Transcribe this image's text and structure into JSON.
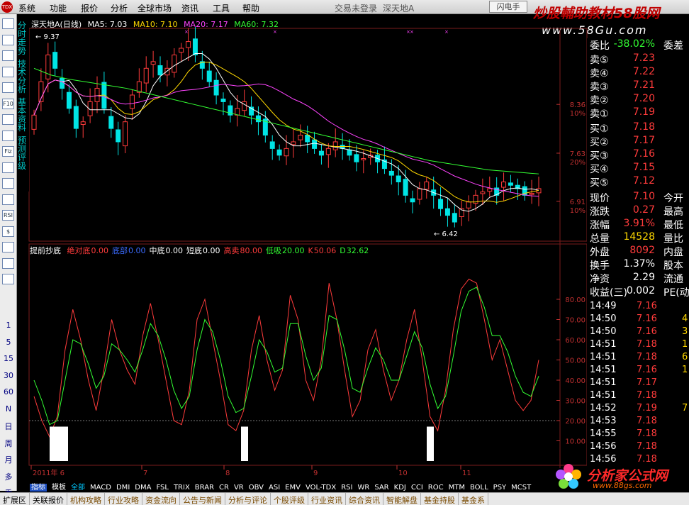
{
  "menu": {
    "items": [
      "系统",
      "功能",
      "报价",
      "分析",
      "全球市场",
      "资讯",
      "工具",
      "帮助"
    ],
    "center": "交易未登录",
    "center2": "深天地A",
    "button": "闪电手"
  },
  "watermark": {
    "line1": "炒股輔助教材58股网",
    "line2": "www.58Gu.com",
    "logo_text": "分析家公式网",
    "logo_url": "www.88gs.com"
  },
  "left_toolbar": {
    "icons": [
      "quote-list-icon",
      "k-line-icon",
      "minute-line-icon",
      "multi-chart-icon",
      "bar-chart-icon",
      "f10-icon",
      "notepad-icon",
      "formula-icon",
      "file-icon",
      "search-icon",
      "grid-icon",
      "rsi-icon",
      "dollar-icon",
      "drag-icon",
      "arrow-icon",
      "pencil-icon",
      "f5-icon"
    ],
    "icon_labels": [
      "",
      "",
      "",
      "",
      "",
      "F10",
      "",
      "",
      "Fiz",
      "",
      "",
      "",
      "RSI",
      "$",
      "",
      "",
      ""
    ],
    "periods": [
      "1",
      "5",
      "15",
      "30",
      "60",
      "N",
      "日",
      "周",
      "月",
      "多",
      "季"
    ]
  },
  "vtabs": [
    "分时走势",
    "技术分析",
    "基本资料",
    "预测评级"
  ],
  "kline": {
    "stock": "深天地A",
    "period": "(日线)",
    "ma5": "MA5: 7.03",
    "ma10": "MA10: 7.10",
    "ma20": "MA20: 7.17",
    "ma60": "MA60: 7.32",
    "high_label": "9.37",
    "low_label": "6.42",
    "price_labels": [
      "8.36",
      "7.63",
      "6.91"
    ],
    "pct_labels": [
      "10%",
      "20%",
      "10%"
    ],
    "date_labels": [
      "2011年 6",
      "7",
      "8",
      "9",
      "10",
      "11"
    ]
  },
  "indicator": {
    "name": "提前抄底",
    "items": [
      {
        "label": "绝对底",
        "value": "0.00",
        "color": "#ff3b3b"
      },
      {
        "label": "底部",
        "value": "0.00",
        "color": "#3b6bff"
      },
      {
        "label": "中底",
        "value": "0.00",
        "color": "#ffffff"
      },
      {
        "label": "短底",
        "value": "0.00",
        "color": "#ffffff"
      },
      {
        "label": "高卖",
        "value": "80.00",
        "color": "#ff3b3b"
      },
      {
        "label": "低吸",
        "value": "20.00",
        "color": "#33ff33"
      },
      {
        "label": "K",
        "value": "50.06",
        "color": "#ff3b3b"
      },
      {
        "label": "D",
        "value": "32.62",
        "color": "#33ff33"
      }
    ],
    "y_labels": [
      "80.00",
      "70.00",
      "60.00",
      "50.00",
      "40.00",
      "30.00",
      "20.00",
      "10.00"
    ]
  },
  "quote": {
    "diff_label": "委比",
    "diff_value": "-38.02%",
    "diff_right": "委差",
    "sells": [
      {
        "label": "卖⑤",
        "price": "7.23"
      },
      {
        "label": "卖④",
        "price": "7.22"
      },
      {
        "label": "卖③",
        "price": "7.21"
      },
      {
        "label": "卖②",
        "price": "7.20"
      },
      {
        "label": "卖①",
        "price": "7.19"
      }
    ],
    "buys": [
      {
        "label": "买①",
        "price": "7.18"
      },
      {
        "label": "买②",
        "price": "7.17"
      },
      {
        "label": "买③",
        "price": "7.16"
      },
      {
        "label": "买④",
        "price": "7.15"
      },
      {
        "label": "买⑤",
        "price": "7.12"
      }
    ],
    "stats": [
      {
        "l": "现价",
        "v": "7.10",
        "r": "今开",
        "c": "#ff3b3b"
      },
      {
        "l": "涨跌",
        "v": "0.27",
        "r": "最高",
        "c": "#ff3b3b"
      },
      {
        "l": "涨幅",
        "v": "3.91%",
        "r": "最低",
        "c": "#ff3b3b"
      },
      {
        "l": "总量",
        "v": "14528",
        "r": "量比",
        "c": "#ffd800"
      },
      {
        "l": "外盘",
        "v": "8092",
        "r": "内盘",
        "c": "#ff3b3b"
      },
      {
        "l": "换手",
        "v": "1.37%",
        "r": "股本",
        "c": "#ffffff"
      },
      {
        "l": "净资",
        "v": "2.29",
        "r": "流通",
        "c": "#ffffff"
      },
      {
        "l": "收益(三)",
        "v": "0.002",
        "r": "PE(动)",
        "c": "#ffffff"
      }
    ],
    "ticks": [
      {
        "t": "14:49",
        "p": "7.16",
        "v": ""
      },
      {
        "t": "14:50",
        "p": "7.16",
        "v": "4"
      },
      {
        "t": "14:50",
        "p": "7.16",
        "v": "3"
      },
      {
        "t": "14:51",
        "p": "7.18",
        "v": "1"
      },
      {
        "t": "14:51",
        "p": "7.18",
        "v": "6"
      },
      {
        "t": "14:51",
        "p": "7.16",
        "v": "1"
      },
      {
        "t": "14:51",
        "p": "7.17",
        "v": ""
      },
      {
        "t": "14:51",
        "p": "7.18",
        "v": ""
      },
      {
        "t": "14:52",
        "p": "7.19",
        "v": "7"
      },
      {
        "t": "14:53",
        "p": "7.18",
        "v": ""
      },
      {
        "t": "14:55",
        "p": "7.18",
        "v": ""
      },
      {
        "t": "14:56",
        "p": "7.18",
        "v": ""
      },
      {
        "t": "14:56",
        "p": "7.18",
        "v": ""
      }
    ]
  },
  "bottom_tabs": [
    "指标",
    "模板",
    "全部",
    "MACD",
    "DMI",
    "DMA",
    "FSL",
    "TRIX",
    "BRAR",
    "CR",
    "VR",
    "OBV",
    "ASI",
    "EMV",
    "VOL-TDX",
    "RSI",
    "WR",
    "SAR",
    "KDJ",
    "CCI",
    "ROC",
    "MTM",
    "BOLL",
    "PSY",
    "MCST"
  ],
  "bottom_links": [
    "扩展区",
    "关联报价",
    "机构攻略",
    "行业攻略",
    "资金流向",
    "公告与新闻",
    "分析与评论",
    "个股评级",
    "行业资讯",
    "综合资讯",
    "智能解盘",
    "基金持股",
    "基金系"
  ],
  "colors": {
    "up": "#ff3b3b",
    "down": "#00e5e5",
    "ma5": "#ffffff",
    "ma10": "#ffd800",
    "ma20": "#ff44ff",
    "ma60": "#33ff33"
  },
  "chart_data": [
    {
      "type": "candlestick",
      "title": "深天地A (日线)",
      "high": 9.37,
      "low": 6.42,
      "ylim": [
        6.42,
        9.37
      ],
      "close": [
        8.2,
        8.7,
        9.1,
        8.9,
        8.6,
        8.3,
        8.0,
        8.1,
        8.4,
        8.6,
        8.3,
        8.0,
        7.8,
        8.1,
        8.5,
        8.7,
        8.9,
        9.0,
        8.8,
        8.9,
        9.1,
        9.2,
        9.3,
        9.1,
        8.9,
        8.7,
        8.5,
        8.4,
        8.2,
        8.3,
        8.4,
        8.2,
        8.1,
        7.9,
        7.7,
        7.6,
        7.7,
        7.8,
        7.9,
        7.8,
        7.7,
        7.6,
        7.7,
        7.8,
        7.7,
        7.6,
        7.5,
        7.55,
        7.6,
        7.5,
        7.4,
        7.3,
        7.2,
        7.0,
        6.9,
        7.1,
        7.2,
        7.0,
        6.8,
        6.7,
        6.6,
        6.8,
        6.9,
        7.0,
        7.05,
        7.1,
        7.0,
        7.2,
        7.15,
        7.1,
        7.0,
        7.03,
        7.1
      ],
      "ma60": [
        8.9,
        8.85,
        8.8,
        8.77,
        8.74,
        8.72,
        8.7,
        8.68,
        8.66,
        8.64,
        8.62,
        8.6,
        8.57,
        8.54,
        8.51,
        8.48,
        8.45,
        8.42,
        8.39,
        8.36,
        8.33,
        8.3,
        8.27,
        8.24,
        8.21,
        8.18,
        8.15,
        8.12,
        8.09,
        8.06,
        8.03,
        8.0,
        7.97,
        7.94,
        7.91,
        7.88,
        7.85,
        7.82,
        7.79,
        7.76,
        7.73,
        7.7,
        7.67,
        7.64,
        7.61,
        7.58,
        7.55,
        7.52,
        7.5,
        7.48,
        7.46,
        7.44,
        7.42,
        7.4,
        7.38,
        7.37,
        7.36,
        7.35,
        7.34,
        7.33,
        7.32
      ]
    },
    {
      "type": "line",
      "title": "提前抄底",
      "ylim": [
        0,
        100
      ],
      "series": [
        {
          "name": "K",
          "values": [
            32,
            20,
            12,
            22,
            55,
            75,
            60,
            40,
            25,
            45,
            70,
            55,
            45,
            38,
            62,
            78,
            60,
            40,
            20,
            18,
            35,
            70,
            80,
            60,
            40,
            18,
            15,
            25,
            55,
            72,
            50,
            35,
            45,
            82,
            70,
            40,
            30,
            50,
            88,
            70,
            45,
            22,
            30,
            55,
            65,
            45,
            30,
            40,
            60,
            75,
            50,
            22,
            15,
            35,
            65,
            85,
            90,
            88,
            70,
            50,
            60,
            45,
            30,
            25,
            30,
            50
          ]
        },
        {
          "name": "D",
          "values": [
            40,
            30,
            18,
            20,
            40,
            60,
            58,
            48,
            36,
            42,
            58,
            55,
            50,
            44,
            55,
            68,
            62,
            50,
            35,
            26,
            32,
            55,
            70,
            64,
            50,
            32,
            24,
            26,
            42,
            60,
            54,
            44,
            46,
            68,
            68,
            52,
            40,
            46,
            72,
            70,
            55,
            36,
            34,
            46,
            56,
            50,
            40,
            40,
            52,
            64,
            56,
            38,
            26,
            32,
            52,
            74,
            84,
            86,
            76,
            62,
            62,
            54,
            42,
            34,
            32,
            42
          ]
        }
      ]
    }
  ]
}
